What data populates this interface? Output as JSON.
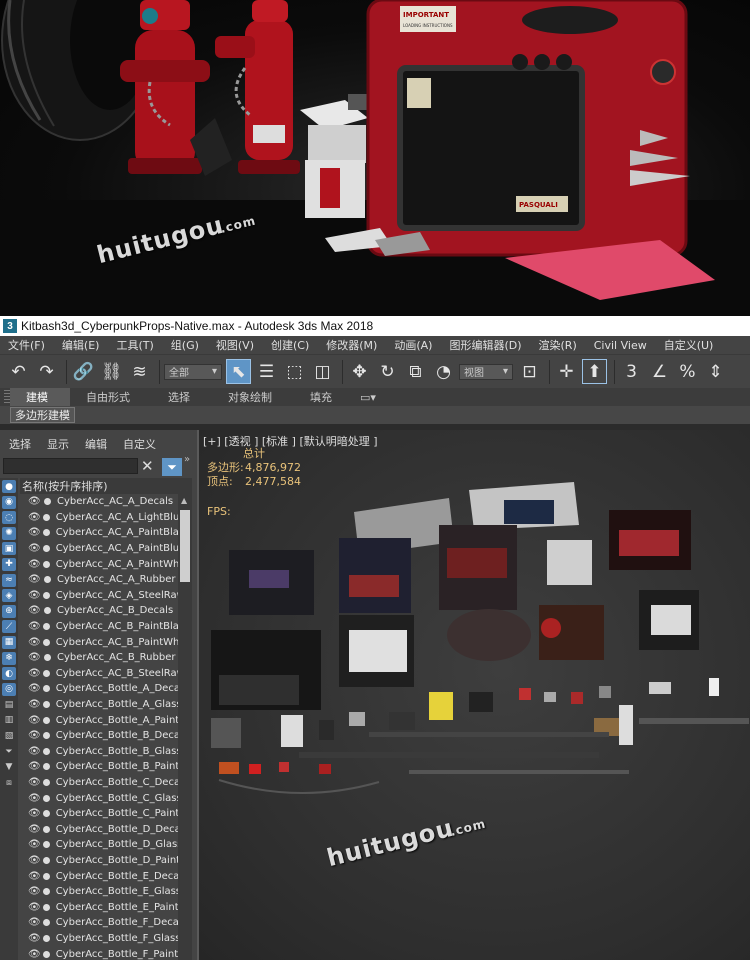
{
  "watermark": {
    "main": "huitugou",
    "sub": ".com"
  },
  "hero": {
    "sign_text": "IMPORTANT",
    "sign_sub": "LOADING INSTRUCTIONS",
    "brand": "PASQUALI"
  },
  "window": {
    "title": "Kitbash3d_CyberpunkProps-Native.max - Autodesk 3ds Max 2018",
    "icon": "3"
  },
  "menu": [
    "文件(F)",
    "编辑(E)",
    "工具(T)",
    "组(G)",
    "视图(V)",
    "创建(C)",
    "修改器(M)",
    "动画(A)",
    "图形编辑器(D)",
    "渲染(R)",
    "Civil View",
    "自定义(U)"
  ],
  "toolbar": {
    "selection_filter": "全部",
    "ref_coord": "视图"
  },
  "ribbon": {
    "tabs": [
      "建模",
      "自由形式",
      "选择",
      "对象绘制",
      "填充"
    ],
    "subtab": "多边形建模"
  },
  "explorer": {
    "menu": [
      "选择",
      "显示",
      "编辑",
      "自定义"
    ],
    "column_header": "名称(按升序排序)",
    "items": [
      "CyberAcc_AC_A_Decals",
      "CyberAcc_AC_A_LightBlue",
      "CyberAcc_AC_A_PaintBlack",
      "CyberAcc_AC_A_PaintBlue",
      "CyberAcc_AC_A_PaintWhite",
      "CyberAcc_AC_A_Rubber",
      "CyberAcc_AC_A_SteelRaw",
      "CyberAcc_AC_B_Decals",
      "CyberAcc_AC_B_PaintBlack",
      "CyberAcc_AC_B_PaintWhite",
      "CyberAcc_AC_B_Rubber",
      "CyberAcc_AC_B_SteelRaw",
      "CyberAcc_Bottle_A_Decals",
      "CyberAcc_Bottle_A_Glass",
      "CyberAcc_Bottle_A_Paint",
      "CyberAcc_Bottle_B_Decals",
      "CyberAcc_Bottle_B_Glass",
      "CyberAcc_Bottle_B_Paint",
      "CyberAcc_Bottle_C_Decals",
      "CyberAcc_Bottle_C_Glass",
      "CyberAcc_Bottle_C_Paint",
      "CyberAcc_Bottle_D_Decals",
      "CyberAcc_Bottle_D_Glass",
      "CyberAcc_Bottle_D_Paint",
      "CyberAcc_Bottle_E_Decals",
      "CyberAcc_Bottle_E_Glass",
      "CyberAcc_Bottle_E_Paint",
      "CyberAcc_Bottle_F_Decals",
      "CyberAcc_Bottle_F_Glass",
      "CyberAcc_Bottle_F_Paint"
    ]
  },
  "viewport": {
    "label": "[+] [透视 ] [标准 ] [默认明暗处理 ]",
    "stats_header": "总计",
    "polygons_label": "多边形:",
    "polygons_value": "4,876,972",
    "vertices_label": "顶点:",
    "vertices_value": "2,477,584",
    "fps_label": "FPS:"
  },
  "colors": {
    "accent": "#5f95c6",
    "stats": "#e8c27a",
    "panel": "#444444"
  }
}
